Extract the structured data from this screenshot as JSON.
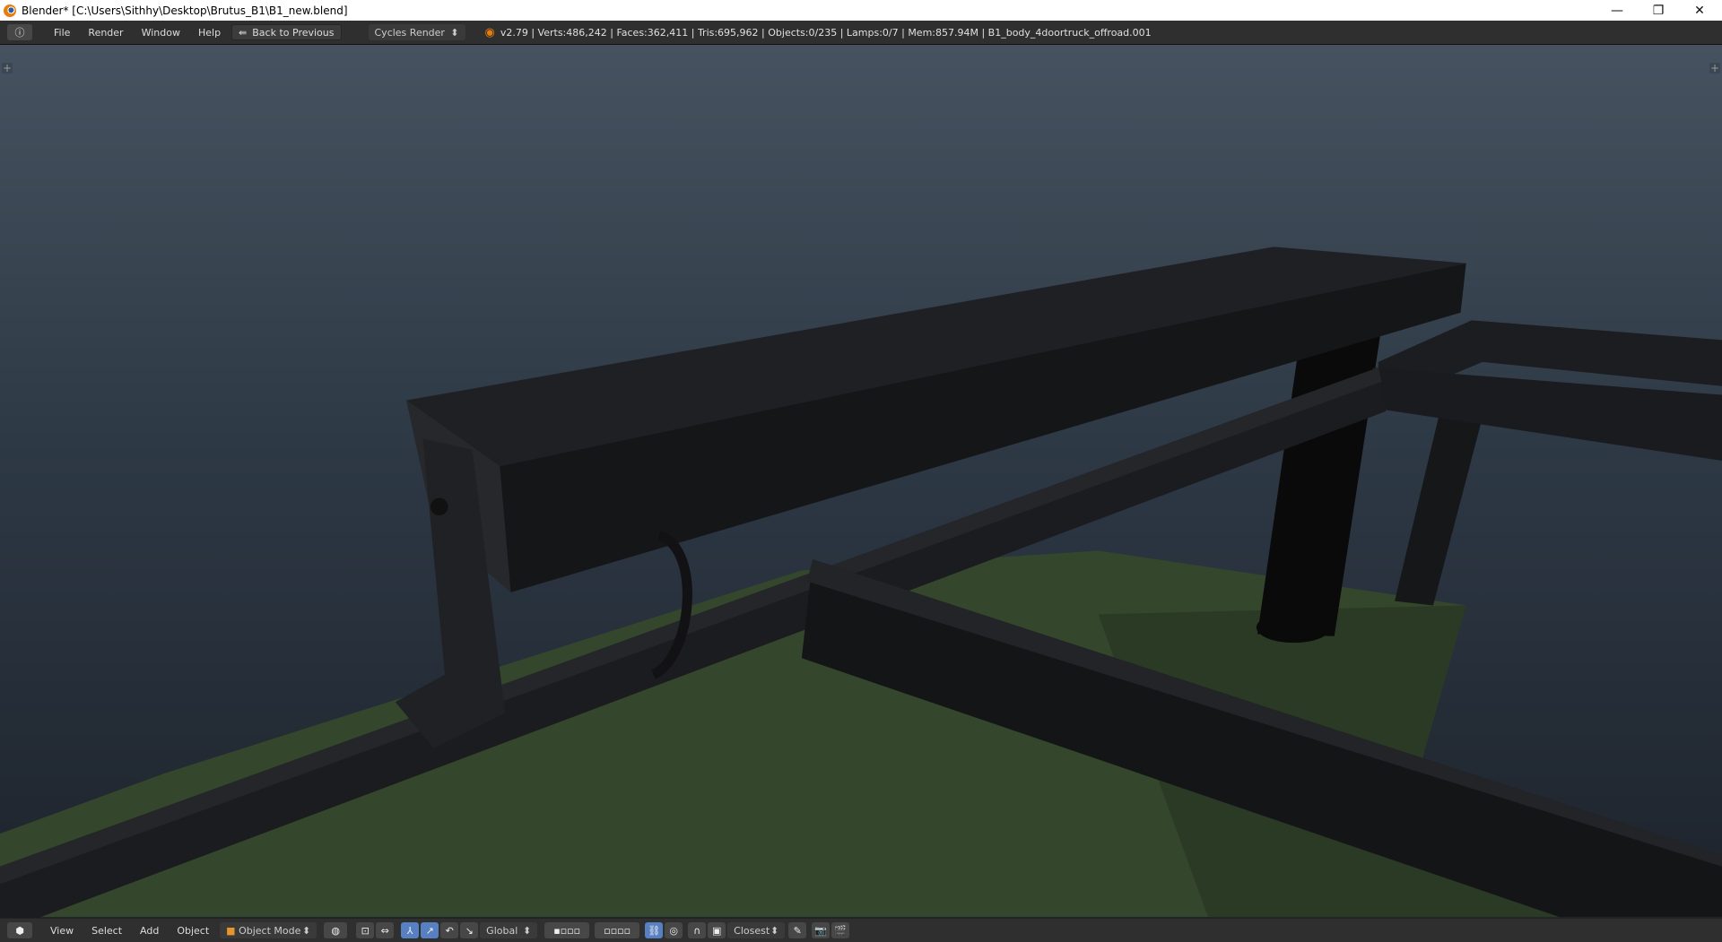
{
  "window": {
    "title": "Blender* [C:\\Users\\Sithhy\\Desktop\\Brutus_B1\\B1_new.blend]",
    "minimize": "—",
    "restore": "❐",
    "close": "✕"
  },
  "header": {
    "menus": [
      "File",
      "Render",
      "Window",
      "Help"
    ],
    "back_button": "Back to Previous",
    "render_engine": "Cycles Render",
    "stats": "v2.79 | Verts:486,242 | Faces:362,411 | Tris:695,962 | Objects:0/235 | Lamps:0/7 | Mem:857.94M | B1_body_4doortruck_offroad.001"
  },
  "footer": {
    "menus": [
      "View",
      "Select",
      "Add",
      "Object"
    ],
    "mode": "Object Mode",
    "orientation": "Global",
    "snap_target": "Closest"
  },
  "colors": {
    "accent": "#5680c2",
    "header_bg": "#2f2f2f",
    "ground": "#34462c"
  }
}
